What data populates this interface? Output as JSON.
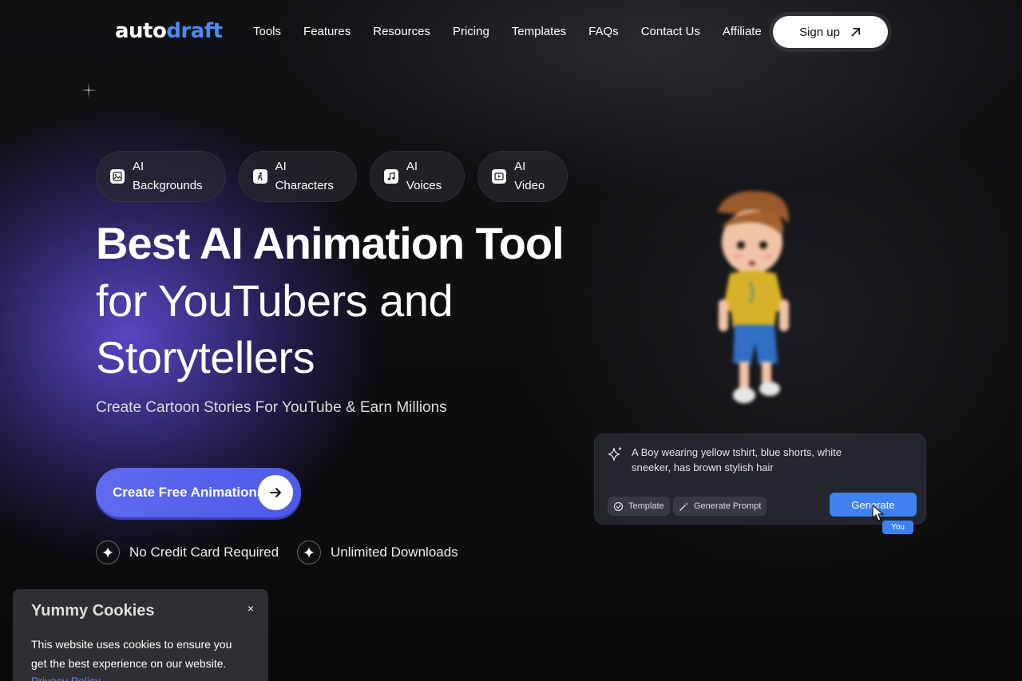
{
  "header": {
    "logo_part1": "auto",
    "logo_part2": "draft",
    "nav": [
      "Tools",
      "Features",
      "Resources",
      "Pricing",
      "Templates",
      "FAQs",
      "Contact Us",
      "Affiliate"
    ],
    "signup_label": "Sign up"
  },
  "pills": [
    {
      "label": "AI\nBackgrounds",
      "icon": "image-icon"
    },
    {
      "label": "AI\nCharacters",
      "icon": "character-icon"
    },
    {
      "label": "AI\nVoices",
      "icon": "music-note-icon"
    },
    {
      "label": "AI\nVideo",
      "icon": "video-icon"
    }
  ],
  "hero": {
    "title": "Best AI Animation Tool",
    "title2": "for YouTubers and Storytellers",
    "subtitle": "Create Cartoon Stories For YouTube & Earn Millions",
    "cta_label": "Create Free Animations",
    "features": [
      "No Credit Card Required",
      "Unlimited Downloads"
    ]
  },
  "prompt_card": {
    "text": "A Boy wearing yellow tshirt, blue shorts, white sneeker, has brown stylish hair",
    "template_label": "Template",
    "generate_prompt_label": "Generate Prompt",
    "generate_label": "Generate",
    "cursor_label": "You"
  },
  "cookie": {
    "title": "Yummy Cookies",
    "close": "×",
    "body": "This website uses cookies to ensure you get the best experience on our website.",
    "link": "Privacy Policy"
  },
  "colors": {
    "brand_blue": "#4b8cf7",
    "cta_purple": "#5f6bf0",
    "generate_blue": "#3d82f0"
  }
}
